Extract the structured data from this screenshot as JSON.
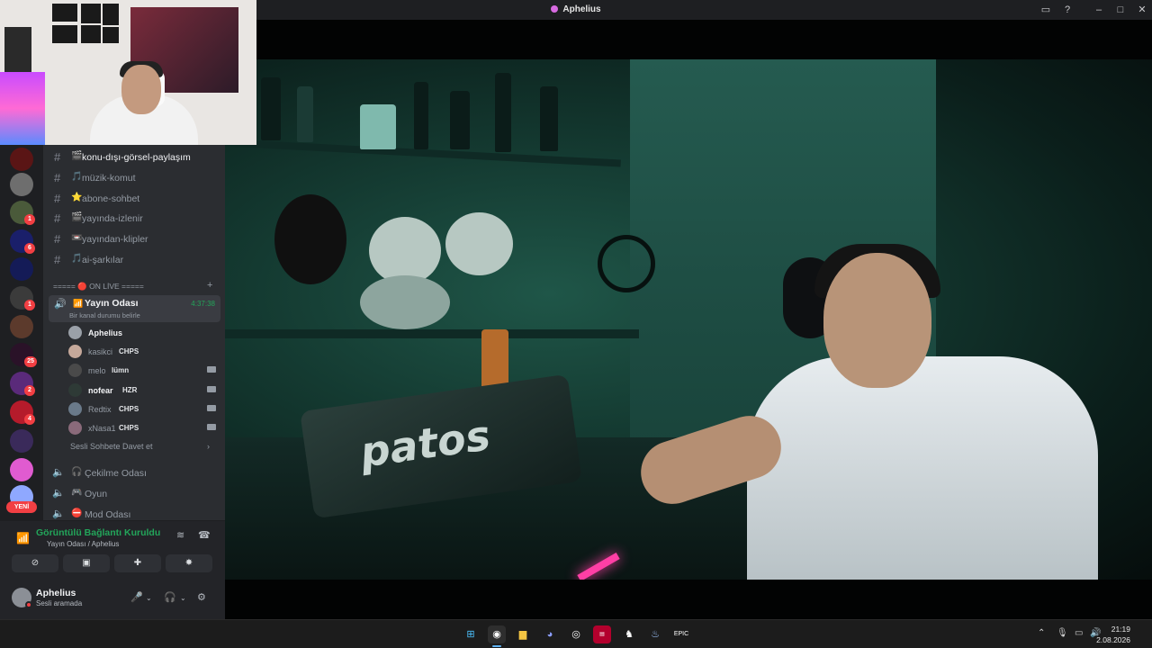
{
  "window": {
    "title": "Aphelius",
    "controls": [
      "picture-in-picture-icon",
      "help-icon",
      "minimize-icon",
      "maximize-icon",
      "close-icon"
    ]
  },
  "sidebar": {
    "text_channels": [
      {
        "emoji": "🎬",
        "label": "konu-dışı-görsel-paylaşım"
      },
      {
        "emoji": "🎵",
        "label": "müzik-komut"
      },
      {
        "emoji": "⭐",
        "label": "abone-sohbet"
      },
      {
        "emoji": "🎬",
        "label": "yayında-izlenir"
      },
      {
        "emoji": "📼",
        "label": "yayından-klipler"
      },
      {
        "emoji": "🎵",
        "label": "ai-şarkılar"
      }
    ],
    "category": {
      "label": "===== 🔴 ON LİVE ====="
    },
    "active_voice": {
      "name": "Yayın Odası",
      "timer": "4:37:38",
      "status": "Bir kanal durumu belirle"
    },
    "members": [
      {
        "name": "Aphelius",
        "tag": "",
        "camera": false,
        "strong": true
      },
      {
        "name": "kasikci",
        "tag": "CHPS",
        "camera": false,
        "strong": false
      },
      {
        "name": "melo",
        "tag": "lümn",
        "camera": true,
        "strong": false
      },
      {
        "name": "nofear",
        "tag": "HZR",
        "camera": true,
        "strong": true
      },
      {
        "name": "Redtix",
        "tag": "CHPS",
        "camera": true,
        "strong": false
      },
      {
        "name": "xNasa1",
        "tag": "CHPS",
        "camera": true,
        "strong": false
      }
    ],
    "invite_label": "Sesli Sohbete Davet et",
    "voice_channels": [
      {
        "emoji": "🎧",
        "label": "Çekilme Odası"
      },
      {
        "emoji": "🎮",
        "label": "Oyun"
      },
      {
        "emoji": "⛔",
        "label": "Mod Odası"
      }
    ],
    "server_badges": [
      "1",
      "6",
      "1",
      "25",
      "2",
      "4"
    ],
    "new_label": "YENİ"
  },
  "voice_panel": {
    "title": "Görüntülü Bağlantı Kuruldu",
    "subtitle": "Yayın Odası / Aphelius"
  },
  "user_panel": {
    "name": "Aphelius",
    "status": "Sesli aramada"
  },
  "taskbar": {
    "time": "21:19",
    "date": "2.08.2026"
  },
  "colors": {
    "discord_green": "#23a55a",
    "badge_red": "#f23f43",
    "sidebar_bg": "#2b2d31",
    "rail_bg": "#1e1f22"
  }
}
